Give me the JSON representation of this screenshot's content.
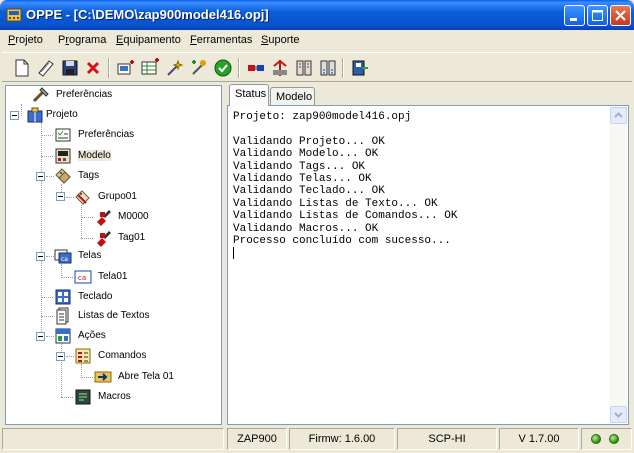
{
  "window": {
    "title": "OPPE - [C:\\DEMO\\zap900model416.opj]"
  },
  "menu": [
    {
      "label": "Projeto",
      "mnemonic": "P"
    },
    {
      "label": "Programa",
      "mnemonic": "r"
    },
    {
      "label": "Equipamento",
      "mnemonic": "E"
    },
    {
      "label": "Ferramentas",
      "mnemonic": "F"
    },
    {
      "label": "Suporte",
      "mnemonic": "S"
    }
  ],
  "toolbar": {
    "buttons": [
      "new-icon",
      "open-icon",
      "save-icon",
      "delete-icon",
      "add-screen-icon",
      "add-table-icon",
      "wizard-icon",
      "compile-icon",
      "check-icon",
      "plug-icon",
      "connect-icon",
      "transfer-icon",
      "receive-icon",
      "exit-icon"
    ],
    "colors": {
      "new": "#ffffff",
      "delete": "#d8101a",
      "check": "#2aa12a",
      "plug": "#c80f1a"
    }
  },
  "tree": {
    "root_preferences": "Preferências",
    "project": "Projeto",
    "project_preferences": "Preferências",
    "model": "Modelo",
    "tags": "Tags",
    "group": "Grupo01",
    "tag_m": "M0000",
    "tag_1": "Tag01",
    "screens": "Telas",
    "screen_1": "Tela01",
    "keyboard": "Teclado",
    "text_lists": "Listas de Textos",
    "actions": "Ações",
    "commands": "Comandos",
    "cmd_open": "Abre Tela 01",
    "macros": "Macros"
  },
  "tabs": [
    {
      "label": "Status",
      "active": true
    },
    {
      "label": "Modelo",
      "active": false
    }
  ],
  "console": {
    "lines": [
      "Projeto: zap900model416.opj",
      "",
      "Validando Projeto... OK",
      "Validando Modelo... OK",
      "Validando Tags... OK",
      "Validando Telas... OK",
      "Validando Teclado... OK",
      "Validando Listas de Texto... OK",
      "Validando Listas de Comandos... OK",
      "Validando Macros... OK",
      "Processo concluído com sucesso..."
    ]
  },
  "status": {
    "model": "ZAP900",
    "firmware": "Firmw: 1.6.00",
    "protocol": "SCP-HI",
    "version": "V 1.7.00",
    "led_color": "#2f8a10"
  }
}
